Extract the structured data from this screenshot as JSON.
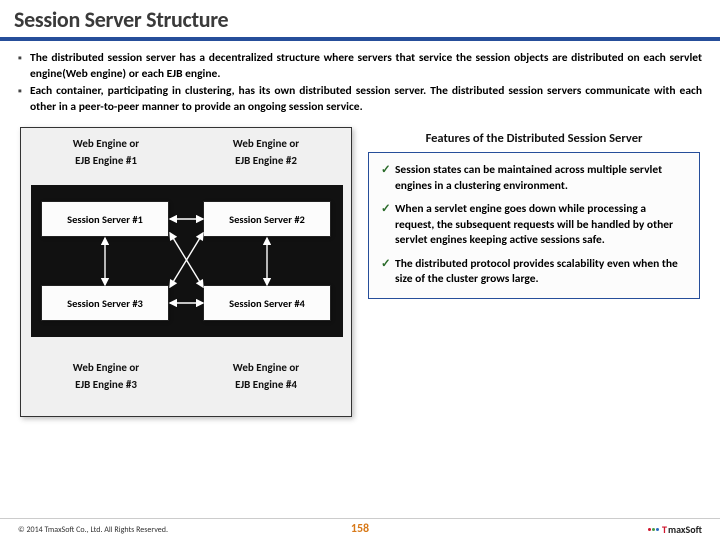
{
  "title": "Session Server Structure",
  "bullets": [
    "The distributed session server has a decentralized structure where servers that service the session objects are distributed on each servlet engine(Web engine) or each EJB engine.",
    "Each container, participating in clustering, has its own distributed session server. The distributed session servers communicate with each other in a peer-to-peer manner to provide an ongoing session service."
  ],
  "diagram": {
    "engines": {
      "tl": {
        "line1": "Web Engine or",
        "line2": "EJB Engine #1"
      },
      "tr": {
        "line1": "Web Engine or",
        "line2": "EJB Engine #2"
      },
      "bl": {
        "line1": "Web Engine or",
        "line2": "EJB Engine #3"
      },
      "br": {
        "line1": "Web Engine or",
        "line2": "EJB Engine #4"
      }
    },
    "servers": {
      "tl": "Session Server #1",
      "tr": "Session Server #2",
      "bl": "Session Server #3",
      "br": "Session Server #4"
    }
  },
  "features": {
    "title": "Features of the Distributed Session Server",
    "items": [
      "Session states can be maintained across multiple servlet engines in a clustering environment.",
      "When a servlet engine goes down while processing a request, the subsequent requests will be handled by other servlet engines keeping active sessions safe.",
      "The distributed protocol provides scalability even when the size of the cluster grows large."
    ]
  },
  "footer": {
    "copyright": "© 2014 TmaxSoft Co., Ltd. All Rights Reserved.",
    "page": "158",
    "logo_t": "T",
    "logo_rest": "maxSoft"
  }
}
